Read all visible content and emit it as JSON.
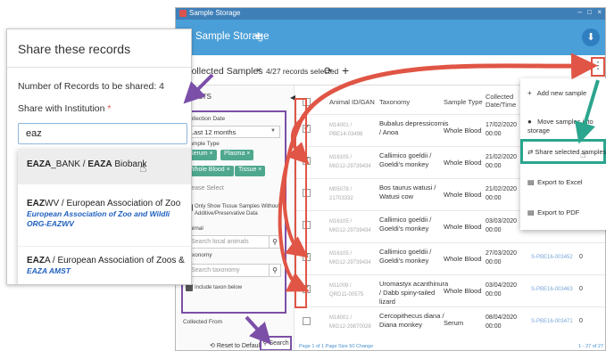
{
  "share": {
    "title": "Share these records",
    "count_label": "Number of Records to be shared: 4",
    "institution_label": "Share with Institution",
    "required_mark": "*",
    "input_value": "eaz",
    "options": [
      {
        "main": "EAZA_BANK / EAZA Biobank",
        "sub1": "",
        "sub2": ""
      },
      {
        "main": "EAZWV / European Association of Zoo",
        "sub1": "European Association of Zoo and Wildli",
        "sub2": "ORG-EAZWV"
      },
      {
        "main": "EAZA / European Association of Zoos &",
        "sub1": "EAZA AMST",
        "sub2": ""
      }
    ]
  },
  "app": {
    "window_title": "Sample Storage",
    "window_controls": [
      "–",
      "□",
      "×"
    ],
    "appbar_title": "Sample Storage",
    "tab_label": "Collected Samples",
    "tab_close": "×",
    "selected_info": "4/27 records selected",
    "kebab": "⋮"
  },
  "filters": {
    "title": "Filters",
    "collection_date_label": "Collection Date",
    "collection_date_value": "Last 12 months",
    "sample_type_label": "Sample Type",
    "chips": [
      "Serum ×",
      "Plasma ×",
      "Whole Blood ×",
      "Tissue ×"
    ],
    "please_select": "Please Select",
    "only_show_text": "Only Show Tissue Samples Without Additive/Preservative Data",
    "animal_label": "Animal",
    "animal_placeholder": "Search local animals",
    "taxonomy_label": "Taxonomy",
    "taxonomy_placeholder": "Search taxonomy",
    "include_taxon": "Include taxon below",
    "collected_from": "Collected From",
    "reset": "Reset to Default",
    "search": "Search"
  },
  "table": {
    "headers": [
      "Animal ID/GAN",
      "Taxonomy",
      "Sample Type",
      "Collected Date/Time"
    ],
    "rows": [
      {
        "checked": true,
        "id1": "M14001 /",
        "id2": "PBE14-03498",
        "tax1": "Bubalus depressicornis",
        "tax2": "/ Anoa",
        "stype": "Whole Blood",
        "date1": "17/02/2020",
        "date2": "00:00",
        "link": "",
        "zero": ""
      },
      {
        "checked": true,
        "id1": "M16105 /",
        "id2": "MIG12-29739434",
        "tax1": "Callimico goeldii /",
        "tax2": "Goeldi's monkey",
        "stype": "Whole Blood",
        "date1": "21/02/2020",
        "date2": "00:00",
        "link": "",
        "zero": ""
      },
      {
        "checked": false,
        "id1": "M05078 /",
        "id2": "21703332",
        "tax1": "Bos taurus watusi /",
        "tax2": "Watusi cow",
        "stype": "Whole Blood",
        "date1": "21/02/2020",
        "date2": "00:00",
        "link": "",
        "zero": ""
      },
      {
        "checked": false,
        "id1": "M16105 /",
        "id2": "MIG12-29739434",
        "tax1": "Callimico goeldii /",
        "tax2": "Goeldi's monkey",
        "stype": "Whole Blood",
        "date1": "03/03/2020",
        "date2": "00:00",
        "link": "",
        "zero": ""
      },
      {
        "checked": true,
        "id1": "M16105 /",
        "id2": "MIG12-29739434",
        "tax1": "Callimico goeldii /",
        "tax2": "Goeldi's monkey",
        "stype": "Whole Blood",
        "date1": "27/03/2020",
        "date2": "00:00",
        "link": "S-PBE16-003452",
        "zero": "0"
      },
      {
        "checked": true,
        "id1": "M11009 /",
        "id2": "QRD11-00575",
        "tax1": "Uromastyx acanthinura",
        "tax2": "/ Dabb spiny-tailed",
        "tax3": "lizard",
        "stype": "Whole Blood",
        "date1": "03/04/2020",
        "date2": "00:00",
        "link": "S-PBE16-003463",
        "zero": "0"
      },
      {
        "checked": false,
        "id1": "M18001 /",
        "id2": "MIG12-29870028",
        "tax1": "Cercopithecus diana /",
        "tax2": "Diana monkey",
        "stype": "Serum",
        "date1": "08/04/2020",
        "date2": "00:00",
        "link": "S-PBE16-003471",
        "zero": "0"
      }
    ],
    "pager_left": "Page  1   of 1   Page Size  50   Change",
    "pager_right": "1 - 27 of 27"
  },
  "menu": {
    "items": [
      {
        "icon": "+",
        "label": "Add new sample"
      },
      {
        "icon": "●",
        "label": "Move samples into storage"
      },
      {
        "icon": "⇄",
        "label": "Share selected samples"
      },
      {
        "icon": "▤",
        "label": "Export to Excel"
      },
      {
        "icon": "▤",
        "label": "Export to PDF"
      }
    ]
  },
  "colors": {
    "appbar": "#4a9fd8",
    "highlight_red": "#e05545",
    "highlight_purple": "#7b4fa8",
    "highlight_teal": "#2ba58e",
    "chip": "#4fa88e"
  }
}
